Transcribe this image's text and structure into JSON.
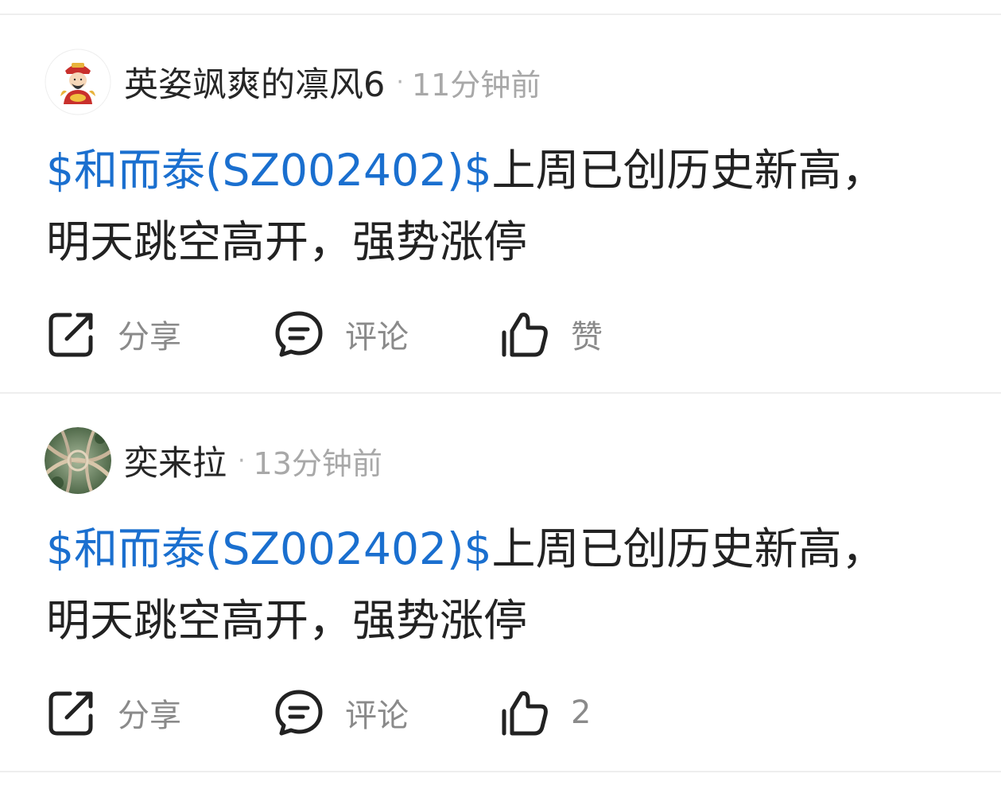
{
  "posts": [
    {
      "username": "英姿飒爽的凛风6",
      "separator": "·",
      "time": "11分钟前",
      "stock_link": "$和而泰(SZ002402)$",
      "body_line1": "上周已创历史新高，",
      "body_line2": "明天跳空高开，强势涨停",
      "share_label": "分享",
      "comment_label": "评论",
      "like_label": "赞",
      "avatar_icon": "god-of-wealth-avatar"
    },
    {
      "username": "奕来拉",
      "separator": "·",
      "time": "13分钟前",
      "stock_link": "$和而泰(SZ002402)$",
      "body_line1": "上周已创历史新高，",
      "body_line2": "明天跳空高开，强势涨停",
      "share_label": "分享",
      "comment_label": "评论",
      "like_label": "2",
      "avatar_icon": "highway-interchange-avatar"
    }
  ],
  "icons": {
    "share": "share-icon",
    "comment": "comment-icon",
    "like": "thumbs-up-icon"
  },
  "colors": {
    "link": "#1a6fcf",
    "text": "#222222",
    "muted": "#a8a8a8",
    "divider": "#eeeeee"
  }
}
